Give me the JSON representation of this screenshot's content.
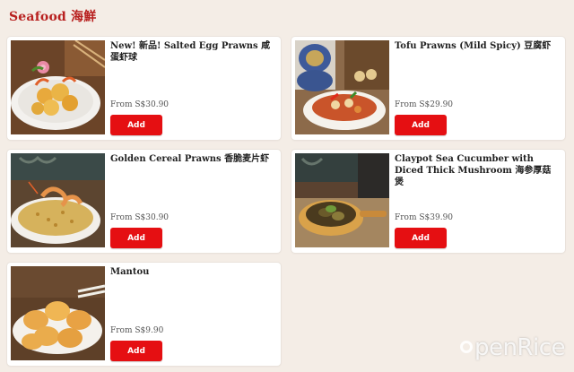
{
  "section": {
    "title": "Seafood 海鮮"
  },
  "items": [
    {
      "name": "New! 新品!  Salted Egg Prawns 咸蛋虾球",
      "price": "From S$30.90",
      "button": "Add",
      "image": "salted-egg-prawns-photo"
    },
    {
      "name": "Tofu Prawns (Mild Spicy) 豆腐虾",
      "price": "From S$29.90",
      "button": "Add",
      "image": "tofu-prawns-photo"
    },
    {
      "name": "Golden Cereal Prawns 香脆麦片虾",
      "price": "From S$30.90",
      "button": "Add",
      "image": "cereal-prawns-photo"
    },
    {
      "name": "Claypot Sea Cucumber with Diced Thick Mushroom 海参厚菇煲",
      "price": "From S$39.90",
      "button": "Add",
      "image": "claypot-sea-cucumber-photo"
    },
    {
      "name": "Mantou",
      "price": "From S$9.90",
      "button": "Add",
      "image": "mantou-photo"
    }
  ],
  "watermark": {
    "text": "penRice",
    "logo": "openrice-logo"
  },
  "colors": {
    "accent": "#b8201f",
    "button": "#e50f12",
    "background": "#f4ede6"
  }
}
